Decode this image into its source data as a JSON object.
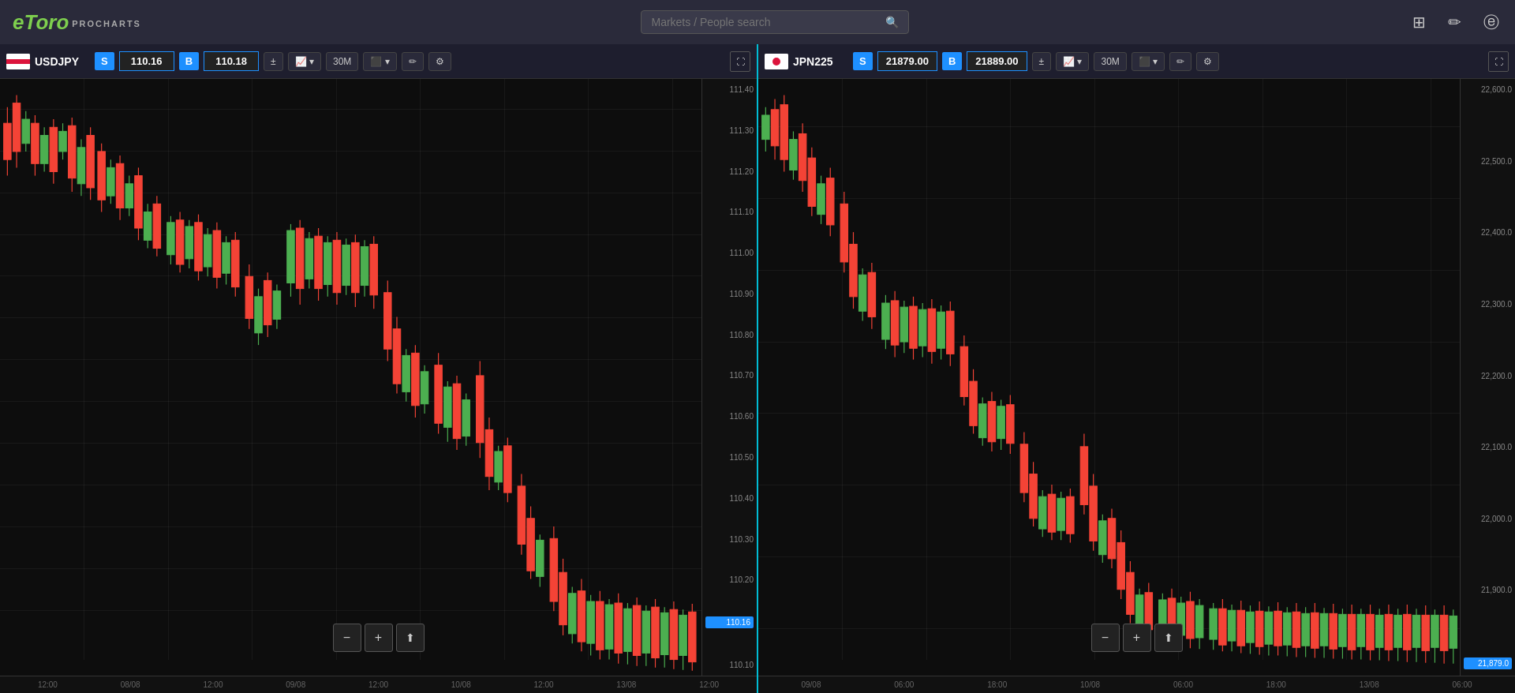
{
  "nav": {
    "logo_etoro": "eToro",
    "logo_procharts": "PROCHARTS",
    "search_placeholder": "Markets / People search"
  },
  "chart1": {
    "instrument": "USDJPY",
    "sell_label": "S",
    "sell_price": "110.16",
    "buy_label": "B",
    "buy_price": "110.18",
    "timeframe": "30M",
    "current_price": "110.16",
    "price_labels": [
      "111.40",
      "111.30",
      "111.20",
      "111.10",
      "111.00",
      "110.90",
      "110.80",
      "110.70",
      "110.60",
      "110.50",
      "110.40",
      "110.30",
      "110.20",
      "110.10"
    ],
    "time_labels": [
      "12:00",
      "08/08",
      "12:00",
      "09/08",
      "12:00",
      "10/08",
      "12:00",
      "13/08",
      "12:00"
    ],
    "zoom_minus": "−",
    "zoom_plus": "+",
    "share": "⬆"
  },
  "chart2": {
    "instrument": "JPN225",
    "sell_label": "S",
    "sell_price": "21879.00",
    "buy_label": "B",
    "buy_price": "21889.00",
    "timeframe": "30M",
    "current_price": "21,879.0",
    "price_labels": [
      "22,600.0",
      "22,500.0",
      "22,400.0",
      "22,300.0",
      "22,200.0",
      "22,100.0",
      "22,000.0",
      "21,900.0"
    ],
    "time_labels": [
      "09/08",
      "06:00",
      "18:00",
      "10/08",
      "06:00",
      "18:00",
      "13/08",
      "06:00"
    ],
    "zoom_minus": "−",
    "zoom_plus": "+",
    "share": "⬆"
  },
  "toolbar": {
    "plus_minus_label": "±",
    "candle_type": "Candles",
    "draw_label": "Draw",
    "settings_label": "⚙",
    "expand_label": "⛶"
  }
}
